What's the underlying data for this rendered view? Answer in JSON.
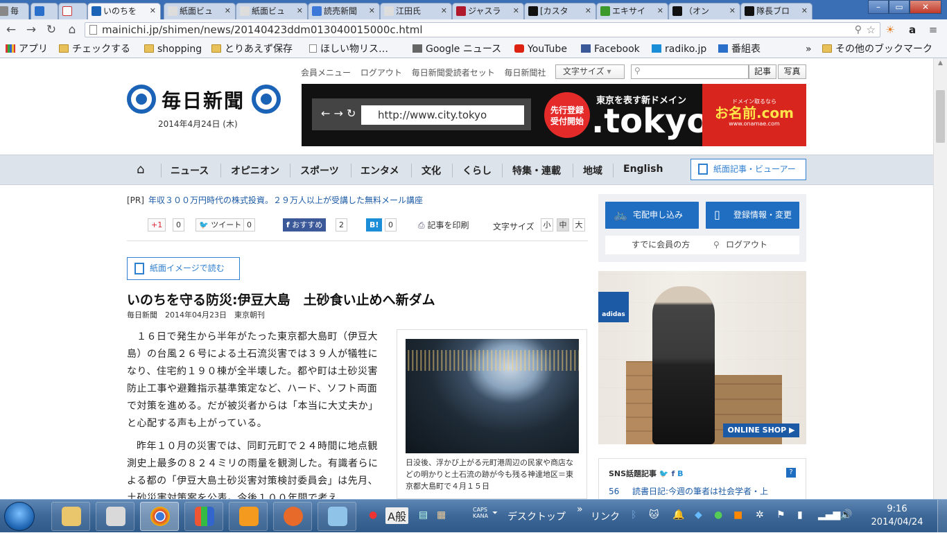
{
  "browser": {
    "tabs": [
      {
        "label": "毎"
      },
      {
        "label": "",
        "icon": "grid"
      },
      {
        "label": "",
        "icon": "gmail"
      },
      {
        "label": "いのちを",
        "active": true
      },
      {
        "label": "紙面ビュ"
      },
      {
        "label": "紙面ビュ"
      },
      {
        "label": "読売新聞"
      },
      {
        "label": "江田氏"
      },
      {
        "label": "ジャスラ"
      },
      {
        "label": "[カスタ"
      },
      {
        "label": "エキサイ"
      },
      {
        "label": "（オン"
      },
      {
        "label": "隊長ブロ"
      }
    ],
    "url": "mainichi.jp/shimen/news/20140423ddm013040015000c.html",
    "window_buttons": {
      "minimize": "–",
      "maximize": "▭",
      "close": "✕"
    },
    "bookmarks": [
      "アプリ",
      "チェックする",
      "shopping",
      "とりあえず保存",
      "ほしい物リス…",
      "Google ニュース",
      "YouTube",
      "Facebook",
      "radiko.jp",
      "番組表"
    ],
    "bookmarks_overflow": "»",
    "other_bookmarks": "その他のブックマーク"
  },
  "site": {
    "top_links": [
      "会員メニュー",
      "ログアウト",
      "毎日新聞愛読者セット",
      "毎日新聞社"
    ],
    "font_size_select": "文字サイズ",
    "search_placeholder": "",
    "search_buttons": [
      "記事",
      "写真"
    ],
    "logo_text": "毎日新聞",
    "date": "2014年4月24日 (木)",
    "ad_banner": {
      "url_text": "http://www.city.tokyo",
      "burst": "先行登録\n受付開始",
      "caption": "東京を表す新ドメイン",
      "domain": ".tokyo",
      "sub_small": "ドメイン取るなら",
      "sub_brand": "お名前.com",
      "sub_url": "www.onamae.com"
    },
    "nav": [
      "ニュース",
      "オピニオン",
      "スポーツ",
      "エンタメ",
      "文化",
      "くらし",
      "特集・連載",
      "地域",
      "English"
    ],
    "viewer_button": "紙面記事・ビューアー",
    "pr_tag": "[PR]",
    "pr_text": "年収３００万円時代の株式投資。２９万人以上が受講した無料メール講座",
    "share": {
      "gplus": "+1",
      "gplus_count": "0",
      "tweet": "ツイート",
      "tweet_count": "0",
      "fb": "おすすめ",
      "fb_count": "2",
      "hatena": "B!",
      "hatena_count": "0",
      "print": "記事を印刷",
      "fontsize_label": "文字サイズ",
      "fontsizes": [
        "小",
        "中",
        "大"
      ]
    },
    "paper_image_button": "紙面イメージで読む",
    "article": {
      "headline": "いのちを守る防災:伊豆大島　土砂食い止めへ新ダム",
      "byline": "毎日新聞　2014年04月23日　東京朝刊",
      "paragraphs": [
        "１６日で発生から半年がたった東京都大島町（伊豆大島）の台風２６号による土石流災害では３９人が犠牲になり、住宅約１９０棟が全半壊した。都や町は土砂災害防止工事や避難指示基準策定など、ハード、ソフト両面で対策を進める。だが被災者からは「本当に大丈夫か」と心配する声も上がっている。",
        "昨年１０月の災害では、同町元町で２４時間に地点観測史上最多の８２４ミリの雨量を観測した。有識者らによる都の「伊豆大島土砂災害対策検討委員会」は先月、土砂災害対策案を公表。今後１００年間で考え"
      ],
      "photo_caption": "日没後、浮かび上がる元町港周辺の民家や商店などの明かりと土石流の跡が今も残る神達地区＝東京都大島町で４月１５日"
    },
    "sidebar": {
      "delivery_button": "宅配申し込み",
      "registration_button": "登録情報・変更",
      "member_text": "すでに会員の方",
      "logout_link": "ログアウト",
      "ad_brand": "adidas",
      "ad_cta": "ONLINE SHOP ▶",
      "sns_title": "SNS話題記事",
      "sns_count": "56",
      "sns_item": "読書日記:今週の筆者は社会学者・上"
    }
  },
  "taskbar": {
    "tray_label_desktop": "デスクトップ",
    "tray_label_link": "リンク",
    "ime": "A般",
    "caps": "CAPS\nKANA",
    "time": "9:16",
    "date": "2014/04/24"
  },
  "colors": {
    "brand_blue": "#1b63b6",
    "link_blue": "#1b5aa6",
    "tokyo_red": "#e52a2a"
  }
}
